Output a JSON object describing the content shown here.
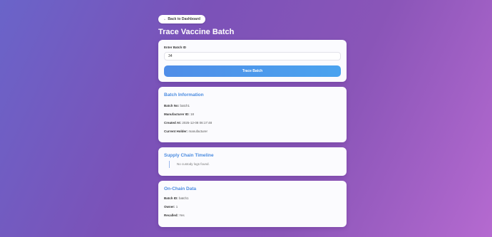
{
  "nav": {
    "back_label": "← Back to Dashboard"
  },
  "page": {
    "title": "Trace Vaccine Batch"
  },
  "search": {
    "label": "Enter Batch ID",
    "value": "34",
    "button_label": "Trace Batch"
  },
  "batch_info": {
    "title": "Batch Information",
    "fields": [
      {
        "key": "Batch No:",
        "value": "batch1"
      },
      {
        "key": "Manufacturer ID:",
        "value": "18"
      },
      {
        "key": "Created At:",
        "value": "2025-12-08 06:17:48"
      },
      {
        "key": "Current Holder:",
        "value": "manufacturer"
      }
    ]
  },
  "timeline": {
    "title": "Supply Chain Timeline",
    "empty_text": "No custody logs found."
  },
  "on_chain": {
    "title": "On-Chain Data",
    "fields": [
      {
        "key": "Batch ID:",
        "value": "batch1"
      },
      {
        "key": "Owner:",
        "value": "1"
      },
      {
        "key": "Recalled:",
        "value": "Yes"
      }
    ]
  }
}
